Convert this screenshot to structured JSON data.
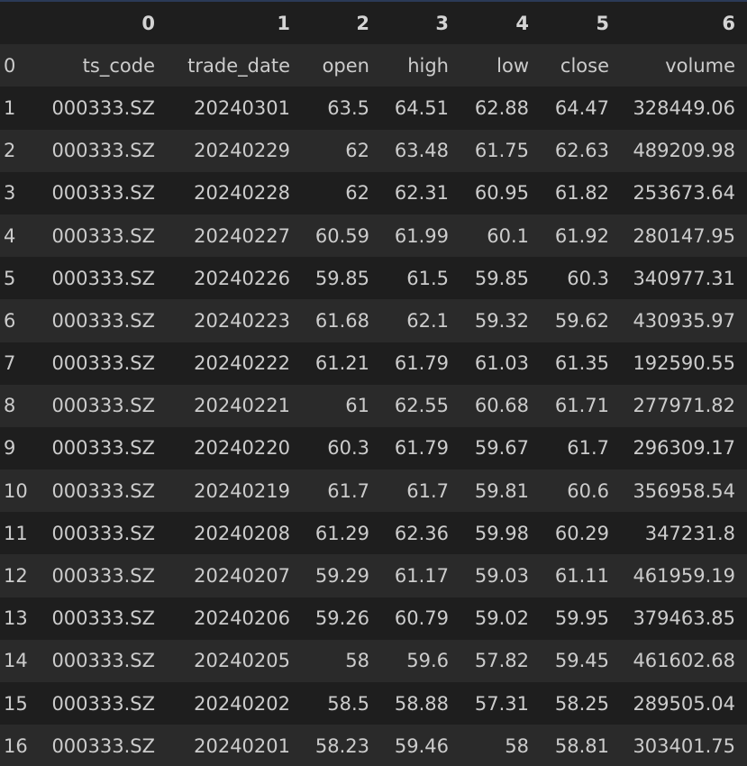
{
  "table": {
    "columns": [
      "0",
      "1",
      "2",
      "3",
      "4",
      "5",
      "6"
    ],
    "rows": [
      {
        "index": "0",
        "cells": [
          "ts_code",
          "trade_date",
          "open",
          "high",
          "low",
          "close",
          "volume"
        ]
      },
      {
        "index": "1",
        "cells": [
          "000333.SZ",
          "20240301",
          "63.5",
          "64.51",
          "62.88",
          "64.47",
          "328449.06"
        ]
      },
      {
        "index": "2",
        "cells": [
          "000333.SZ",
          "20240229",
          "62",
          "63.48",
          "61.75",
          "62.63",
          "489209.98"
        ]
      },
      {
        "index": "3",
        "cells": [
          "000333.SZ",
          "20240228",
          "62",
          "62.31",
          "60.95",
          "61.82",
          "253673.64"
        ]
      },
      {
        "index": "4",
        "cells": [
          "000333.SZ",
          "20240227",
          "60.59",
          "61.99",
          "60.1",
          "61.92",
          "280147.95"
        ]
      },
      {
        "index": "5",
        "cells": [
          "000333.SZ",
          "20240226",
          "59.85",
          "61.5",
          "59.85",
          "60.3",
          "340977.31"
        ]
      },
      {
        "index": "6",
        "cells": [
          "000333.SZ",
          "20240223",
          "61.68",
          "62.1",
          "59.32",
          "59.62",
          "430935.97"
        ]
      },
      {
        "index": "7",
        "cells": [
          "000333.SZ",
          "20240222",
          "61.21",
          "61.79",
          "61.03",
          "61.35",
          "192590.55"
        ]
      },
      {
        "index": "8",
        "cells": [
          "000333.SZ",
          "20240221",
          "61",
          "62.55",
          "60.68",
          "61.71",
          "277971.82"
        ]
      },
      {
        "index": "9",
        "cells": [
          "000333.SZ",
          "20240220",
          "60.3",
          "61.79",
          "59.67",
          "61.7",
          "296309.17"
        ]
      },
      {
        "index": "10",
        "cells": [
          "000333.SZ",
          "20240219",
          "61.7",
          "61.7",
          "59.81",
          "60.6",
          "356958.54"
        ]
      },
      {
        "index": "11",
        "cells": [
          "000333.SZ",
          "20240208",
          "61.29",
          "62.36",
          "59.98",
          "60.29",
          "347231.8"
        ]
      },
      {
        "index": "12",
        "cells": [
          "000333.SZ",
          "20240207",
          "59.29",
          "61.17",
          "59.03",
          "61.11",
          "461959.19"
        ]
      },
      {
        "index": "13",
        "cells": [
          "000333.SZ",
          "20240206",
          "59.26",
          "60.79",
          "59.02",
          "59.95",
          "379463.85"
        ]
      },
      {
        "index": "14",
        "cells": [
          "000333.SZ",
          "20240205",
          "58",
          "59.6",
          "57.82",
          "59.45",
          "461602.68"
        ]
      },
      {
        "index": "15",
        "cells": [
          "000333.SZ",
          "20240202",
          "58.5",
          "58.88",
          "57.31",
          "58.25",
          "289505.04"
        ]
      },
      {
        "index": "16",
        "cells": [
          "000333.SZ",
          "20240201",
          "58.23",
          "59.46",
          "58",
          "58.81",
          "303401.75"
        ]
      }
    ]
  }
}
